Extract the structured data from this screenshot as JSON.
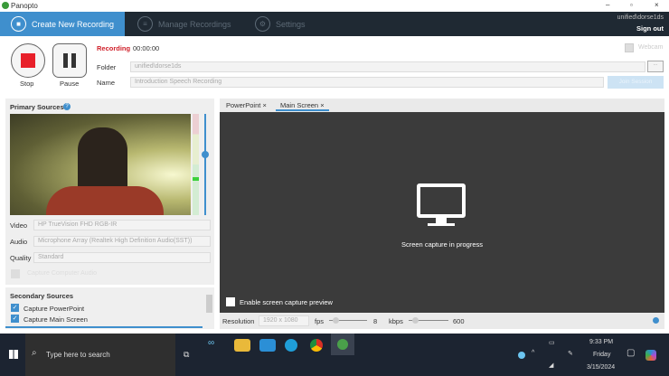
{
  "window": {
    "title": "Panopto",
    "controls": [
      "–",
      "▫",
      "×"
    ]
  },
  "nav": {
    "tabs": [
      {
        "label": "Create New Recording"
      },
      {
        "label": "Manage Recordings"
      },
      {
        "label": "Settings"
      }
    ],
    "user": "unified\\dorse1ds",
    "sign_out": "Sign out"
  },
  "controls": {
    "stop": "Stop",
    "pause": "Pause",
    "status": "Recording",
    "time": "00:00:00",
    "folder_label": "Folder",
    "folder_value": "unified\\dorse1ds",
    "name_label": "Name",
    "name_value": "Introduction Speech Recording",
    "webcam": "Webcam",
    "join_button": "Join Session",
    "browse": "..."
  },
  "primary": {
    "title": "Primary Sources",
    "video_label": "Video",
    "video_value": "HP TrueVision FHD RGB-IR",
    "audio_label": "Audio",
    "audio_value": "Microphone Array (Realtek High Definition Audio(SST))",
    "quality_label": "Quality",
    "quality_value": "Standard",
    "computer_audio": "Capture Computer Audio",
    "audio_level": 0.35
  },
  "secondary": {
    "title": "Secondary Sources",
    "items": [
      {
        "label": "Capture PowerPoint",
        "checked": true
      },
      {
        "label": "Capture Main Screen",
        "checked": true
      }
    ]
  },
  "tabs": [
    {
      "label": "PowerPoint"
    },
    {
      "label": "Main Screen",
      "active": true
    }
  ],
  "stage": {
    "message": "Screen capture in progress",
    "preview": "Enable screen capture preview"
  },
  "bottom": {
    "resolution_label": "Resolution",
    "resolution": "1920 x 1080",
    "fps_label": "fps",
    "fps": "8",
    "kbps_label": "kbps",
    "kbps": "600"
  },
  "taskbar": {
    "search": "Type here to search",
    "time": "9:33 PM",
    "day": "Friday",
    "date": "3/15/2024"
  },
  "colors": {
    "accent": "#3f8fcd",
    "recording": "#d0202a",
    "nav": "#1f2933"
  }
}
